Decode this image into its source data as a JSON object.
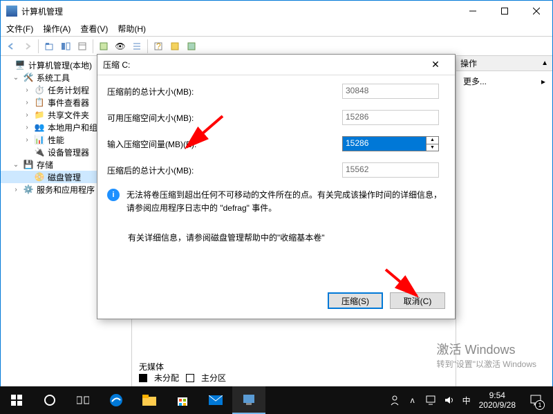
{
  "window": {
    "title": "计算机管理",
    "menus": [
      "文件(F)",
      "操作(A)",
      "查看(V)",
      "帮助(H)"
    ]
  },
  "tree": {
    "root": "计算机管理(本地)",
    "sys_tools": "系统工具",
    "task_sched": "任务计划程",
    "event_viewer": "事件查看器",
    "shared": "共享文件夹",
    "local_users": "本地用户和组",
    "perf": "性能",
    "dev_mgr": "设备管理器",
    "storage": "存储",
    "disk_mgmt": "磁盘管理",
    "services": "服务和应用程序"
  },
  "actions": {
    "header": "操作",
    "row_more": "更多..."
  },
  "bottom": {
    "no_media": "无媒体",
    "unallocated": "未分配",
    "primary": "主分区"
  },
  "dialog": {
    "title": "压缩 C:",
    "before_label": "压缩前的总计大小(MB):",
    "before_value": "30848",
    "avail_label": "可用压缩空间大小(MB):",
    "avail_value": "15286",
    "input_label": "输入压缩空间量(MB)(E):",
    "input_value": "15286",
    "after_label": "压缩后的总计大小(MB):",
    "after_value": "15562",
    "info_text": "无法将卷压缩到超出任何不可移动的文件所在的点。有关完成该操作时间的详细信息，请参阅应用程序日志中的 \"defrag\" 事件。",
    "link_text": "有关详细信息，请参阅磁盘管理帮助中的\"收缩基本卷\"",
    "ok": "压缩(S)",
    "cancel": "取消(C)"
  },
  "watermark": {
    "line1": "激活 Windows",
    "line2": "转到\"设置\"以激活 Windows"
  },
  "taskbar": {
    "ime": "中",
    "time": "9:54",
    "date": "2020/9/28",
    "notif_count": "1"
  }
}
